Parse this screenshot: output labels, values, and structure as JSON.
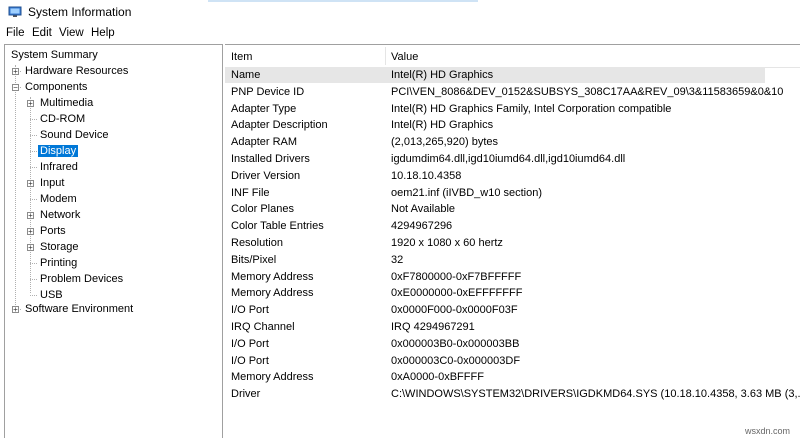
{
  "window": {
    "title": "System Information"
  },
  "menu": {
    "file": "File",
    "edit": "Edit",
    "view": "View",
    "help": "Help"
  },
  "tree": {
    "root": "System Summary",
    "hardware": "Hardware Resources",
    "components": "Components",
    "children": [
      {
        "label": "Multimedia",
        "expandable": true
      },
      {
        "label": "CD-ROM",
        "expandable": false
      },
      {
        "label": "Sound Device",
        "expandable": false
      },
      {
        "label": "Display",
        "expandable": false,
        "selected": true
      },
      {
        "label": "Infrared",
        "expandable": false
      },
      {
        "label": "Input",
        "expandable": true
      },
      {
        "label": "Modem",
        "expandable": false
      },
      {
        "label": "Network",
        "expandable": true
      },
      {
        "label": "Ports",
        "expandable": true
      },
      {
        "label": "Storage",
        "expandable": true
      },
      {
        "label": "Printing",
        "expandable": false
      },
      {
        "label": "Problem Devices",
        "expandable": false
      },
      {
        "label": "USB",
        "expandable": false
      }
    ],
    "software": "Software Environment"
  },
  "table": {
    "headers": {
      "item": "Item",
      "value": "Value"
    },
    "rows": [
      {
        "item": "Name",
        "value": "Intel(R) HD Graphics"
      },
      {
        "item": "PNP Device ID",
        "value": "PCI\\VEN_8086&DEV_0152&SUBSYS_308C17AA&REV_09\\3&11583659&0&10"
      },
      {
        "item": "Adapter Type",
        "value": "Intel(R) HD Graphics Family, Intel Corporation compatible"
      },
      {
        "item": "Adapter Description",
        "value": "Intel(R) HD Graphics"
      },
      {
        "item": "Adapter RAM",
        "value": "(2,013,265,920) bytes"
      },
      {
        "item": "Installed Drivers",
        "value": "igdumdim64.dll,igd10iumd64.dll,igd10iumd64.dll"
      },
      {
        "item": "Driver Version",
        "value": "10.18.10.4358"
      },
      {
        "item": "INF File",
        "value": "oem21.inf (iIVBD_w10 section)"
      },
      {
        "item": "Color Planes",
        "value": "Not Available"
      },
      {
        "item": "Color Table Entries",
        "value": "4294967296"
      },
      {
        "item": "Resolution",
        "value": "1920 x 1080 x 60 hertz"
      },
      {
        "item": "Bits/Pixel",
        "value": "32"
      },
      {
        "item": "Memory Address",
        "value": "0xF7800000-0xF7BFFFFF"
      },
      {
        "item": "Memory Address",
        "value": "0xE0000000-0xEFFFFFFF"
      },
      {
        "item": "I/O Port",
        "value": "0x0000F000-0x0000F03F"
      },
      {
        "item": "IRQ Channel",
        "value": "IRQ 4294967291"
      },
      {
        "item": "I/O Port",
        "value": "0x000003B0-0x000003BB"
      },
      {
        "item": "I/O Port",
        "value": "0x000003C0-0x000003DF"
      },
      {
        "item": "Memory Address",
        "value": "0xA0000-0xBFFFF"
      },
      {
        "item": "Driver",
        "value": "C:\\WINDOWS\\SYSTEM32\\DRIVERS\\IGDKMD64.SYS (10.18.10.4358, 3.63 MB (3,..."
      }
    ]
  },
  "watermark": "wsxdn.com",
  "colors": {
    "selection": "#0078d7",
    "first_row": "#e6e6e6"
  }
}
